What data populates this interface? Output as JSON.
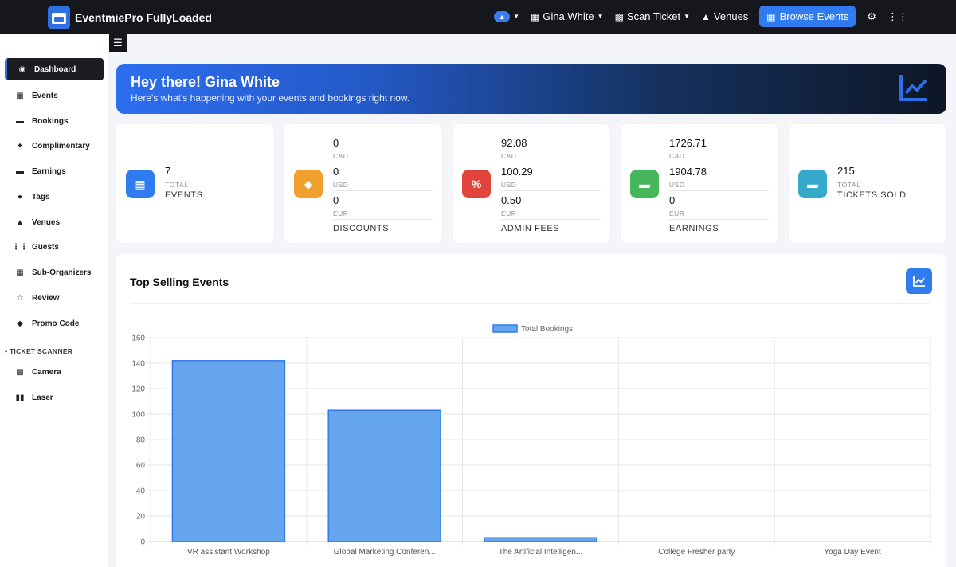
{
  "app": {
    "brand": "EventmiePro FullyLoaded"
  },
  "topnav": {
    "user_name": "Gina White",
    "scan_ticket": "Scan Ticket",
    "venues": "Venues",
    "browse_events": "Browse Events"
  },
  "sidebar": {
    "items": [
      {
        "label": "Dashboard",
        "icon": "dashboard-icon"
      },
      {
        "label": "Events",
        "icon": "calendar-icon"
      },
      {
        "label": "Bookings",
        "icon": "ticket-icon"
      },
      {
        "label": "Complimentary",
        "icon": "puzzle-icon"
      },
      {
        "label": "Earnings",
        "icon": "wallet-icon"
      },
      {
        "label": "Tags",
        "icon": "users-icon"
      },
      {
        "label": "Venues",
        "icon": "map-icon"
      },
      {
        "label": "Guests",
        "icon": "group-icon"
      },
      {
        "label": "Sub-Organizers",
        "icon": "organizer-icon"
      },
      {
        "label": "Review",
        "icon": "star-icon"
      },
      {
        "label": "Promo Code",
        "icon": "tag-icon"
      }
    ],
    "section_label": "TICKET SCANNER",
    "scanner_items": [
      {
        "label": "Camera",
        "icon": "camera-icon"
      },
      {
        "label": "Laser",
        "icon": "barcode-icon"
      }
    ]
  },
  "banner": {
    "title": "Hey there! Gina White",
    "subtitle": "Here's what's happening with your events and bookings right now."
  },
  "stats": {
    "events": {
      "value": "7",
      "sub": "TOTAL",
      "label": "EVENTS",
      "color": "#2f7bef"
    },
    "discounts": {
      "rows": [
        {
          "value": "0",
          "cur": "CAD"
        },
        {
          "value": "0",
          "cur": "USD"
        },
        {
          "value": "0",
          "cur": "EUR"
        }
      ],
      "label": "DISCOUNTS",
      "color": "#f0a02c"
    },
    "admin_fees": {
      "rows": [
        {
          "value": "92.08",
          "cur": "CAD"
        },
        {
          "value": "100.29",
          "cur": "USD"
        },
        {
          "value": "0.50",
          "cur": "EUR"
        }
      ],
      "label": "ADMIN FEES",
      "color": "#e0443a"
    },
    "earnings": {
      "rows": [
        {
          "value": "1726.71",
          "cur": "CAD"
        },
        {
          "value": "1904.78",
          "cur": "USD"
        },
        {
          "value": "0",
          "cur": "EUR"
        }
      ],
      "label": "EARNINGS",
      "color": "#45b65a"
    },
    "tickets": {
      "value": "215",
      "sub": "TOTAL",
      "label": "TICKETS SOLD",
      "color": "#35a9c9"
    }
  },
  "panel": {
    "title": "Top Selling Events"
  },
  "chart_data": {
    "type": "bar",
    "title": "",
    "xlabel": "",
    "ylabel": "",
    "categories": [
      "VR assistant Workshop",
      "Global Marketing Conferen...",
      "The Artificial Intelligen...",
      "College Fresher party",
      "Yoga Day Event"
    ],
    "series": [
      {
        "name": "Total Bookings",
        "values": [
          142,
          103,
          3,
          0,
          0
        ]
      }
    ],
    "ylim": [
      0,
      160
    ],
    "yticks": [
      0,
      20,
      40,
      60,
      80,
      100,
      120,
      140,
      160
    ],
    "grid": true,
    "legend": "top",
    "bar_color": "#64a5ee",
    "bar_border": "#2f7bef"
  }
}
